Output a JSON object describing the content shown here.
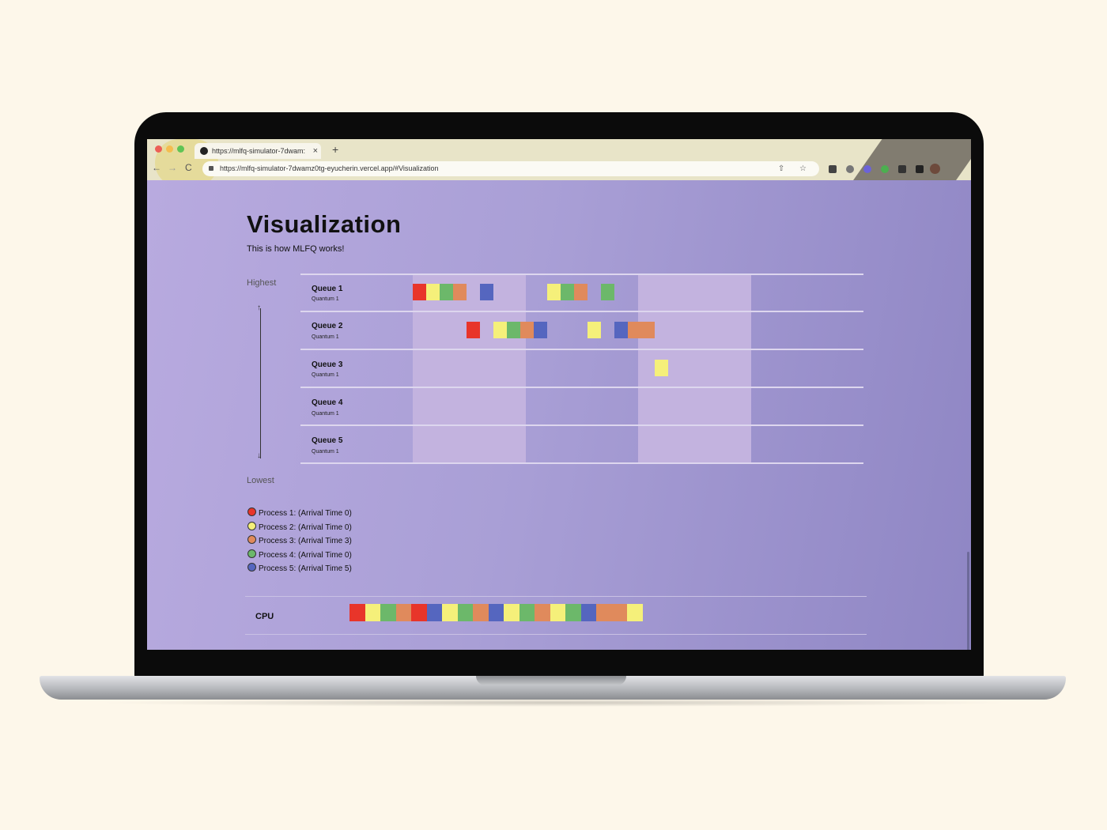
{
  "browser": {
    "tab_title": "https://mlfq-simulator-7dwam:",
    "tab_close": "×",
    "new_tab": "+",
    "url": "https://mlfq-simulator-7dwamz0tg-eyucherin.vercel.app/#Visualization",
    "nav": {
      "back": "←",
      "forward": "→",
      "reload": "C"
    },
    "omnibox_icons": "⇧ ☆"
  },
  "page": {
    "title": "Visualization",
    "subtitle": "This is how MLFQ works!",
    "axis_top": "Highest",
    "axis_bottom": "Lowest",
    "arrow_up": "↑",
    "arrow_down": "↓"
  },
  "queues": [
    {
      "name": "Queue 1",
      "quantum": "Quantum 1"
    },
    {
      "name": "Queue 2",
      "quantum": "Quantum 1"
    },
    {
      "name": "Queue 3",
      "quantum": "Quantum 1"
    },
    {
      "name": "Queue 4",
      "quantum": "Quantum 1"
    },
    {
      "name": "Queue 5",
      "quantum": "Quantum 1"
    }
  ],
  "processes": [
    {
      "id": 1,
      "label": "Process 1:",
      "arrival": "(Arrival Time 0)",
      "color": "#e8352a"
    },
    {
      "id": 2,
      "label": "Process 2:",
      "arrival": "(Arrival Time 0)",
      "color": "#f5f07a"
    },
    {
      "id": 3,
      "label": "Process 3:",
      "arrival": "(Arrival Time 3)",
      "color": "#e08a5c"
    },
    {
      "id": 4,
      "label": "Process 4:",
      "arrival": "(Arrival Time 0)",
      "color": "#6cb86a"
    },
    {
      "id": 5,
      "label": "Process 5:",
      "arrival": "(Arrival Time 5)",
      "color": "#5566bf"
    }
  ],
  "queue_timeline": [
    {
      "queue": 1,
      "slot": 0,
      "process": 1
    },
    {
      "queue": 1,
      "slot": 1,
      "process": 2
    },
    {
      "queue": 1,
      "slot": 2,
      "process": 4
    },
    {
      "queue": 1,
      "slot": 3,
      "process": 3
    },
    {
      "queue": 1,
      "slot": 5,
      "process": 5
    },
    {
      "queue": 1,
      "slot": 10,
      "process": 2
    },
    {
      "queue": 1,
      "slot": 11,
      "process": 4
    },
    {
      "queue": 1,
      "slot": 12,
      "process": 3
    },
    {
      "queue": 1,
      "slot": 14,
      "process": 4
    },
    {
      "queue": 2,
      "slot": 4,
      "process": 1
    },
    {
      "queue": 2,
      "slot": 6,
      "process": 2
    },
    {
      "queue": 2,
      "slot": 7,
      "process": 4
    },
    {
      "queue": 2,
      "slot": 8,
      "process": 3
    },
    {
      "queue": 2,
      "slot": 9,
      "process": 5
    },
    {
      "queue": 2,
      "slot": 13,
      "process": 2
    },
    {
      "queue": 2,
      "slot": 15,
      "process": 5
    },
    {
      "queue": 2,
      "slot": 16,
      "process": 3
    },
    {
      "queue": 2,
      "slot": 17,
      "process": 3
    },
    {
      "queue": 3,
      "slot": 18,
      "process": 2
    }
  ],
  "cpu": {
    "label": "CPU",
    "sequence": [
      1,
      2,
      4,
      3,
      1,
      5,
      2,
      4,
      3,
      5,
      2,
      4,
      3,
      2,
      4,
      5,
      3,
      3,
      2
    ]
  }
}
